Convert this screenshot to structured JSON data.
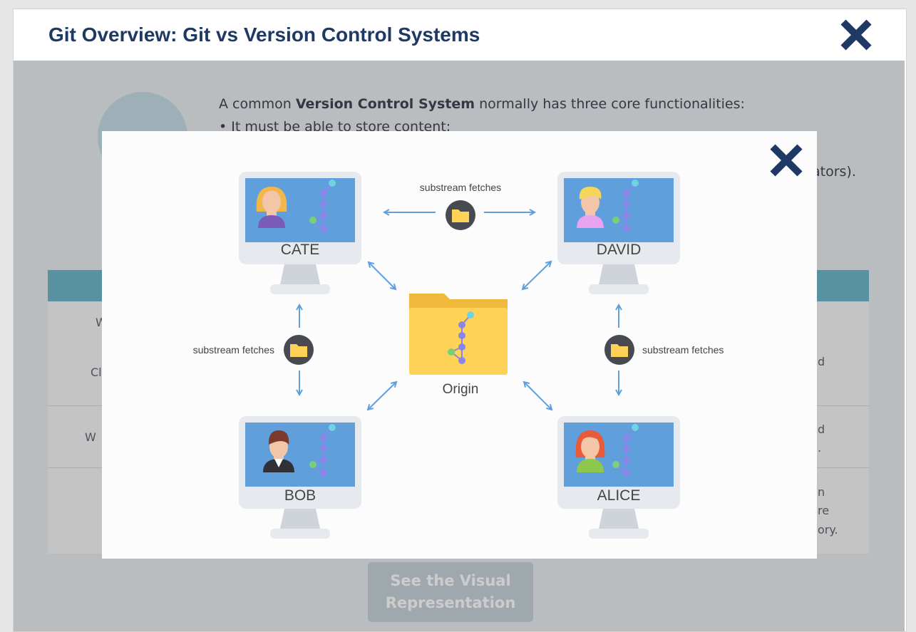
{
  "window": {
    "title": "Git Overview: Git vs Version Control Systems",
    "close_icon": "close-x-icon"
  },
  "background": {
    "intro_prefix": "A common ",
    "intro_bold": "Version Control System",
    "intro_suffix": " normally has three core functionalities:",
    "bullet_1": "• It must be able to store content;",
    "line_tail": "ators).",
    "table_fragments": {
      "r1_left_a": "W",
      "r1_left_b": "Cl",
      "r1_right": "d",
      "r2_left": "W",
      "r2_right_a": "d",
      "r2_right_b": ".",
      "r3_right_a": "n",
      "r3_right_b": "re",
      "r3_right_c": "ory."
    },
    "button_label_line1": "See the Visual",
    "button_label_line2": "Representation"
  },
  "modal": {
    "close_icon": "close-x-icon",
    "nodes": {
      "cate": "CATE",
      "david": "DAVID",
      "bob": "BOB",
      "alice": "ALICE",
      "origin": "Origin"
    },
    "edge_labels": {
      "top": "substream fetches",
      "left": "substream fetches",
      "right": "substream fetches"
    },
    "colors": {
      "accent_blue": "#5f9fdb",
      "monitor_gray": "#e6e9ee",
      "folder_yellow": "#fdd257",
      "node_purple": "#8a86e9",
      "node_teal": "#6fd3e3",
      "node_green": "#7ad07a",
      "close_navy": "#1e3a64"
    }
  }
}
